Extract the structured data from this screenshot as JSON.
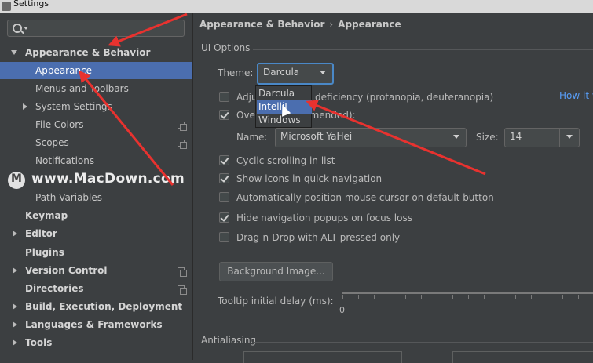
{
  "window": {
    "title": "Settings"
  },
  "sidebar": {
    "items": [
      {
        "label": "Appearance & Behavior"
      },
      {
        "label": "Appearance"
      },
      {
        "label": "Menus and Toolbars"
      },
      {
        "label": "System Settings"
      },
      {
        "label": "File Colors"
      },
      {
        "label": "Scopes"
      },
      {
        "label": "Notifications"
      },
      {
        "label": "Path Variables"
      },
      {
        "label": "Keymap"
      },
      {
        "label": "Editor"
      },
      {
        "label": "Plugins"
      },
      {
        "label": "Version Control"
      },
      {
        "label": "Directories"
      },
      {
        "label": "Build, Execution, Deployment"
      },
      {
        "label": "Languages & Frameworks"
      },
      {
        "label": "Tools"
      }
    ]
  },
  "watermark": {
    "logo_letter": "M",
    "text": "www.MacDown.com"
  },
  "breadcrumb": {
    "parent": "Appearance & Behavior",
    "current": "Appearance"
  },
  "ui_options": {
    "group_title": "UI Options",
    "theme_label": "Theme:",
    "theme_value": "Darcula",
    "theme_options": [
      "Darcula",
      "IntelliJ",
      "Windows"
    ],
    "selected_option": "IntelliJ",
    "adjust_colors_label": "Adju        reen vision deficiency (protanopia, deuteranopia)",
    "adjust_link": "How it w",
    "override_fonts_label": "Ove                 (not recommended):",
    "name_label": "Name:",
    "font_name": "Microsoft YaHei",
    "size_label": "Size:",
    "font_size": "14",
    "checks": [
      {
        "label": "Cyclic scrolling in list",
        "checked": true
      },
      {
        "label": "Show icons in quick navigation",
        "checked": true
      },
      {
        "label": "Automatically position mouse cursor on default button",
        "checked": false
      },
      {
        "label": "Hide navigation popups on focus loss",
        "checked": true
      },
      {
        "label": "Drag-n-Drop with ALT pressed only",
        "checked": false
      }
    ],
    "background_button": "Background Image...",
    "tooltip_label": "Tooltip initial delay (ms):",
    "tooltip_min": "0"
  },
  "antialiasing": {
    "group_title": "Antialiasing"
  },
  "colors": {
    "selection": "#4b6eaf",
    "annotation_arrow": "#e8322f",
    "link": "#589df6"
  }
}
